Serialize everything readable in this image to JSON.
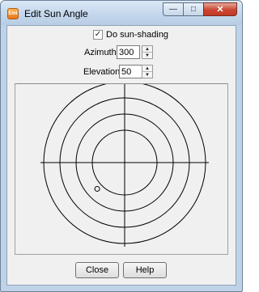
{
  "window": {
    "title": "Edit Sun Angle",
    "app_icon_text": "Emt",
    "controls": {
      "minimize": "—",
      "maximize": "□",
      "close": "✕"
    }
  },
  "shading": {
    "label": "Do sun-shading",
    "checked": true,
    "check_glyph": "✓"
  },
  "azimuth": {
    "label": "Azimuth:",
    "value": "300",
    "up": "▲",
    "down": "▼"
  },
  "elevation": {
    "label": "Elevation:",
    "value": "50",
    "up": "▲",
    "down": "▼"
  },
  "sky_chart": {
    "rings": 4,
    "sun_marker": {
      "azimuth": 300,
      "elevation": 50
    }
  },
  "buttons": {
    "close": "Close",
    "help": "Help"
  }
}
